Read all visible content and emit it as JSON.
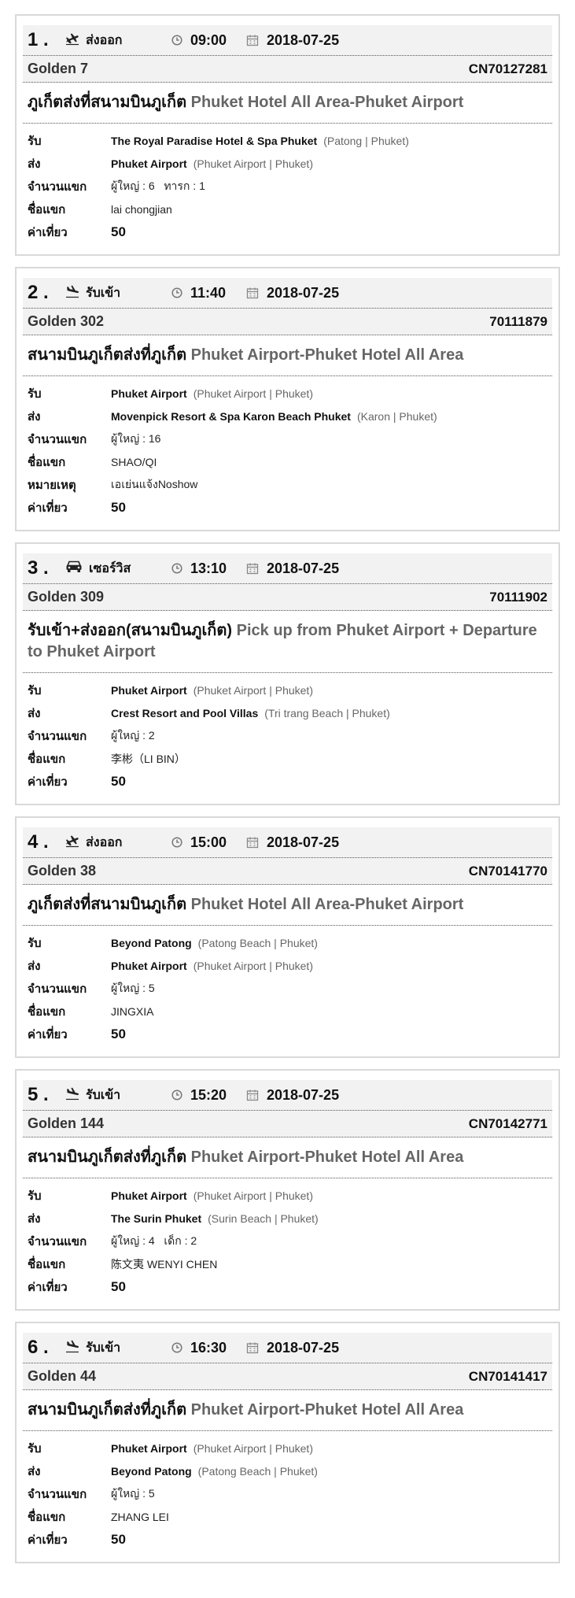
{
  "labels": {
    "pickup": "รับ",
    "dropoff": "ส่ง",
    "passengers": "จำนวนแขก",
    "guest": "ชื่อแขก",
    "note": "หมายเหตุ",
    "fare": "ค่าเที่ยว"
  },
  "bookings": [
    {
      "num": "1 .",
      "type": "ส่งออก",
      "icon": "airplane-departure-icon",
      "time": "09:00",
      "date": "2018-07-25",
      "vehicle": "Golden 7",
      "order": "CN70127281",
      "title_th": "ภูเก็ตส่งที่สนามบินภูเก็ต",
      "title_en": "Phuket Hotel All Area-Phuket Airport",
      "pickup_main": "The Royal Paradise Hotel & Spa Phuket",
      "pickup_sub": "(Patong | Phuket)",
      "dropoff_main": "Phuket Airport",
      "dropoff_sub": "(Phuket Airport | Phuket)",
      "passengers": "ผู้ใหญ่ : 6   ทารก : 1",
      "guest": "lai chongjian",
      "note": null,
      "fare": "50"
    },
    {
      "num": "2 .",
      "type": "รับเข้า",
      "icon": "airplane-arrival-icon",
      "time": "11:40",
      "date": "2018-07-25",
      "vehicle": "Golden 302",
      "order": "70111879",
      "title_th": "สนามบินภูเก็ตส่งที่ภูเก็ต",
      "title_en": "Phuket Airport-Phuket Hotel All Area",
      "pickup_main": "Phuket Airport",
      "pickup_sub": "(Phuket Airport | Phuket)",
      "dropoff_main": "Movenpick Resort & Spa Karon Beach Phuket",
      "dropoff_sub": "(Karon | Phuket)",
      "passengers": "ผู้ใหญ่ : 16",
      "guest": "SHAO/QI",
      "note": "เอเย่นแจ้งNoshow",
      "fare": "50"
    },
    {
      "num": "3 .",
      "type": "เซอร์วิส",
      "icon": "car-icon",
      "time": "13:10",
      "date": "2018-07-25",
      "vehicle": "Golden 309",
      "order": "70111902",
      "title_th": "รับเข้า+ส่งออก(สนามบินภูเก็ต)",
      "title_en": "Pick up from Phuket Airport + Departure to Phuket Airport",
      "pickup_main": "Phuket Airport",
      "pickup_sub": "(Phuket Airport | Phuket)",
      "dropoff_main": "Crest Resort and Pool Villas",
      "dropoff_sub": "(Tri trang Beach | Phuket)",
      "passengers": "ผู้ใหญ่ : 2",
      "guest": "李彬（LI BIN）",
      "note": null,
      "fare": "50"
    },
    {
      "num": "4 .",
      "type": "ส่งออก",
      "icon": "airplane-departure-icon",
      "time": "15:00",
      "date": "2018-07-25",
      "vehicle": "Golden 38",
      "order": "CN70141770",
      "title_th": "ภูเก็ตส่งที่สนามบินภูเก็ต",
      "title_en": "Phuket Hotel All Area-Phuket Airport",
      "pickup_main": "Beyond Patong",
      "pickup_sub": "(Patong Beach | Phuket)",
      "dropoff_main": "Phuket Airport",
      "dropoff_sub": "(Phuket Airport | Phuket)",
      "passengers": "ผู้ใหญ่ : 5",
      "guest": "JINGXIA",
      "note": null,
      "fare": "50"
    },
    {
      "num": "5 .",
      "type": "รับเข้า",
      "icon": "airplane-arrival-icon",
      "time": "15:20",
      "date": "2018-07-25",
      "vehicle": "Golden 144",
      "order": "CN70142771",
      "title_th": "สนามบินภูเก็ตส่งที่ภูเก็ต",
      "title_en": "Phuket Airport-Phuket Hotel All Area",
      "pickup_main": "Phuket Airport",
      "pickup_sub": "(Phuket Airport | Phuket)",
      "dropoff_main": "The Surin Phuket",
      "dropoff_sub": "(Surin Beach | Phuket)",
      "passengers": "ผู้ใหญ่ : 4   เด็ก : 2",
      "guest": "陈文夷 WENYI CHEN",
      "note": null,
      "fare": "50"
    },
    {
      "num": "6 .",
      "type": "รับเข้า",
      "icon": "airplane-arrival-icon",
      "time": "16:30",
      "date": "2018-07-25",
      "vehicle": "Golden 44",
      "order": "CN70141417",
      "title_th": "สนามบินภูเก็ตส่งที่ภูเก็ต",
      "title_en": "Phuket Airport-Phuket Hotel All Area",
      "pickup_main": "Phuket Airport",
      "pickup_sub": "(Phuket Airport | Phuket)",
      "dropoff_main": "Beyond Patong",
      "dropoff_sub": "(Patong Beach | Phuket)",
      "passengers": "ผู้ใหญ่ : 5",
      "guest": "ZHANG LEI",
      "note": null,
      "fare": "50"
    }
  ]
}
